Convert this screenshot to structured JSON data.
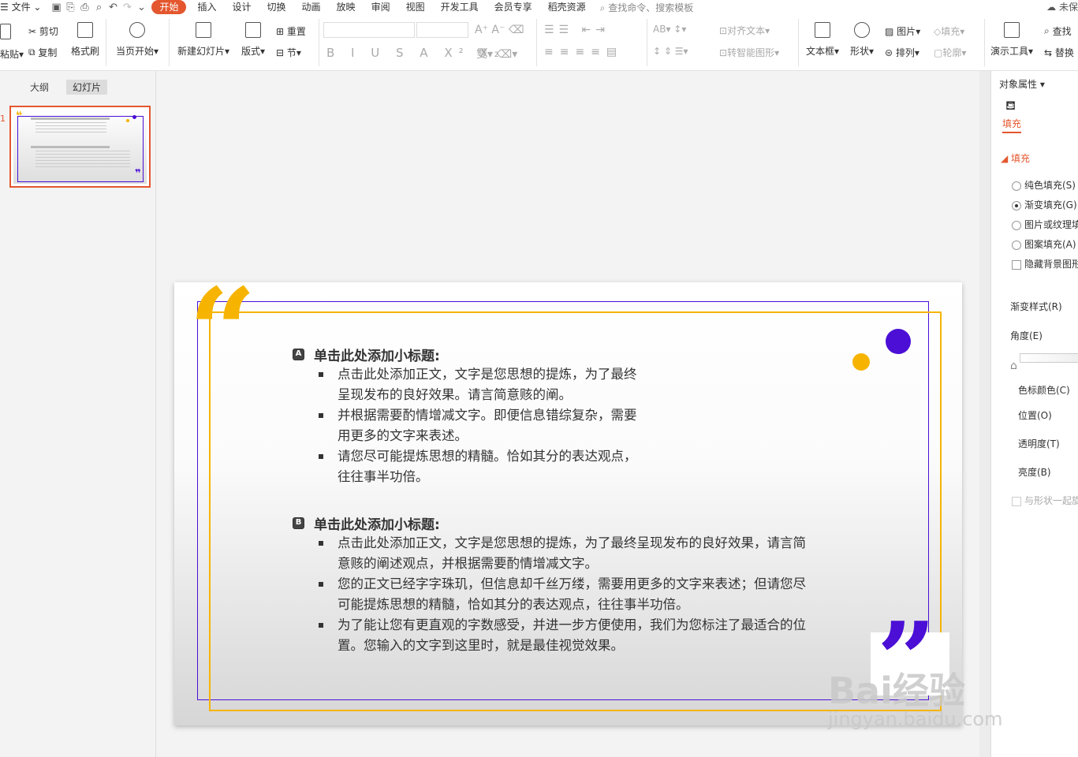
{
  "menubar": {
    "file_label": "文件",
    "tabs": [
      {
        "label": "开始",
        "active": true
      },
      {
        "label": "插入"
      },
      {
        "label": "设计"
      },
      {
        "label": "切换"
      },
      {
        "label": "动画"
      },
      {
        "label": "放映"
      },
      {
        "label": "审阅"
      },
      {
        "label": "视图"
      },
      {
        "label": "开发工具"
      },
      {
        "label": "会员专享"
      },
      {
        "label": "稻壳资源"
      }
    ],
    "search_placeholder": "查找命令、搜索模板",
    "unsaved_label": "未保"
  },
  "toolbar": {
    "paste": "粘贴",
    "cut": "剪切",
    "copy": "复制",
    "format_painter": "格式刷",
    "from_current": "当页开始",
    "new_slide": "新建幻灯片",
    "layout": "版式",
    "reset": "重置",
    "section": "节",
    "align_text": "对齐文本",
    "smartart": "转智能图形",
    "textbox": "文本框",
    "shape": "形状",
    "picture": "图片",
    "arrange": "排列",
    "fill": "填充",
    "outline": "轮廓",
    "presenter_tools": "演示工具",
    "find": "查找",
    "replace": "替换"
  },
  "left_panel": {
    "tab_outline": "大纲",
    "tab_slides": "幻灯片",
    "thumb_number": "1"
  },
  "slide": {
    "section_a": {
      "badge": "A",
      "title": "单击此处添加小标题:",
      "bullets": [
        "点击此处添加正文，文字是您思想的提炼，为了最终呈现发布的良好效果。请言简意赅的阐。",
        "并根据需要酌情增减文字。即便信息错综复杂，需要用更多的文字来表述。",
        "请您尽可能提炼思想的精髓。恰如其分的表达观点，往往事半功倍。"
      ]
    },
    "section_b": {
      "badge": "B",
      "title": "单击此处添加小标题:",
      "bullets": [
        "点击此处添加正文，文字是您思想的提炼，为了最终呈现发布的良好效果，请言简意赅的阐述观点，并根据需要酌情增减文字。",
        "您的正文已经字字珠玑，但信息却千丝万缕，需要用更多的文字来表述；但请您尽可能提炼思想的精髓，恰如其分的表达观点，往往事半功倍。",
        "为了能让您有更直观的字数感受，并进一步方便使用，我们为您标注了最适合的位置。您输入的文字到这里时，就是最佳视觉效果。"
      ]
    },
    "colors": {
      "accent_yellow": "#f6b400",
      "accent_purple": "#4b0fd6"
    }
  },
  "right_panel": {
    "title": "对象属性",
    "fill_tab": "填充",
    "fill_section": "填充",
    "options": [
      "纯色填充(S)",
      "渐变填充(G)",
      "图片或纹理填",
      "图案填充(A)"
    ],
    "selected_option": "渐变填充(G)",
    "hide_bg": "隐藏背景图形",
    "gradient_style": "渐变样式(R)",
    "angle": "角度(E)",
    "stop_color": "色标颜色(C)",
    "position": "位置(O)",
    "transparency": "透明度(T)",
    "brightness": "亮度(B)",
    "rotate_with_shape": "与形状一起旋"
  },
  "watermark": {
    "text": "Bai经验",
    "sub": "jingyan.baidu.com"
  }
}
